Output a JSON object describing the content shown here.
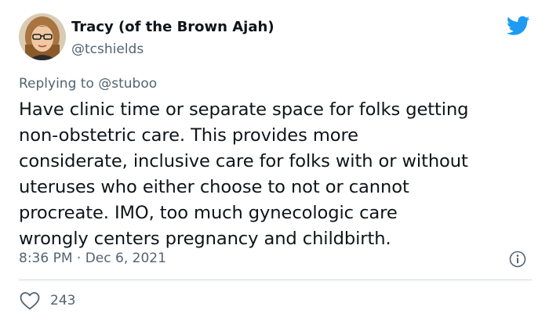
{
  "author": {
    "display_name": "Tracy (of the Brown Ajah)",
    "handle": "@tcshields",
    "avatar_icon": "profile-photo"
  },
  "brand": {
    "logo_icon": "twitter-bird-icon",
    "accent_color": "#1d9bf0"
  },
  "reply": {
    "prefix": "Replying to",
    "mention": "@stuboo"
  },
  "tweet": {
    "lines": [
      "Have clinic time or separate space for folks getting",
      "non-obstetric care. This provides more",
      "considerate, inclusive care for folks with or without",
      "uteruses who either choose to not or cannot",
      "procreate. IMO, too much gynecologic care",
      "wrongly centers pregnancy and childbirth."
    ],
    "timestamp": "8:36 PM · Dec 6, 2021"
  },
  "actions": {
    "like_icon": "heart-icon",
    "like_count": "243",
    "info_icon": "info-icon"
  },
  "colors": {
    "text_primary": "#0f1419",
    "text_secondary": "#536471",
    "divider": "#cfd9de"
  }
}
